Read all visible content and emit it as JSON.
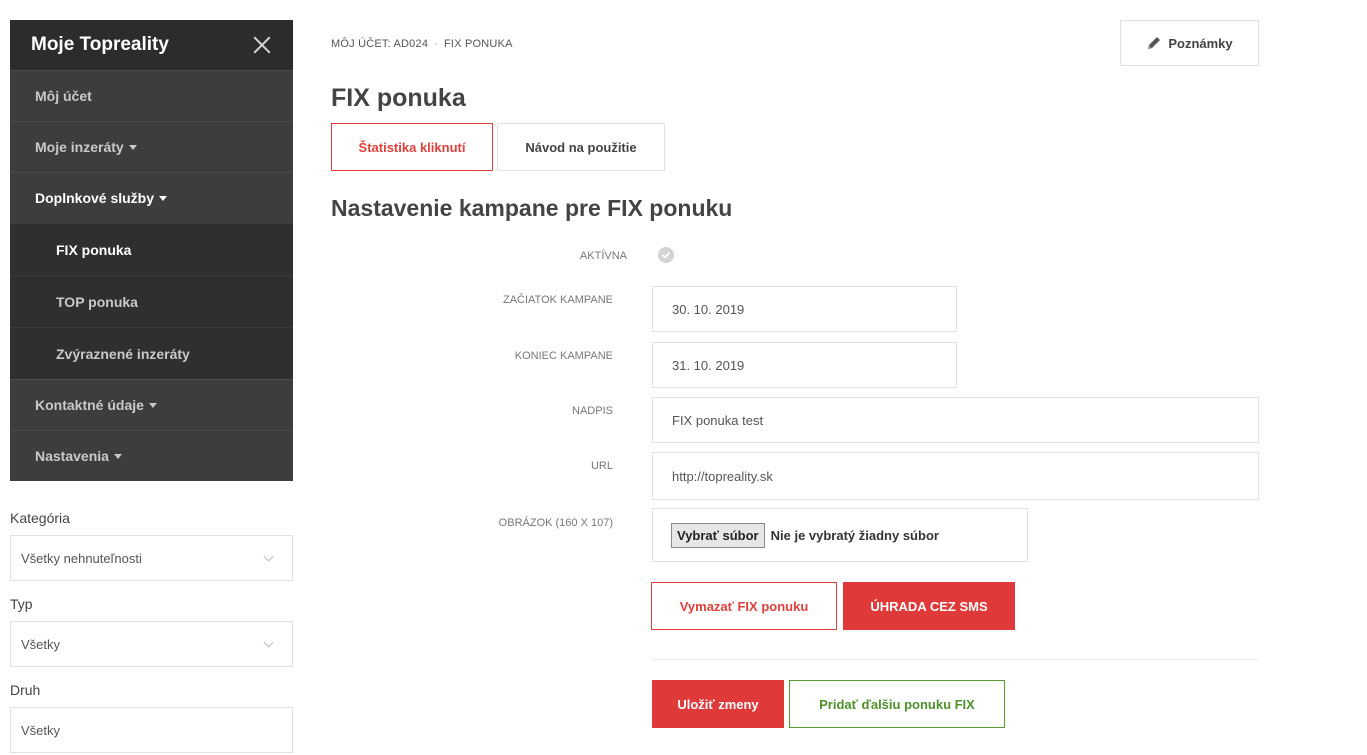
{
  "sidebar": {
    "title": "Moje Topreality",
    "items": [
      {
        "label": "Môj účet"
      },
      {
        "label": "Moje inzeráty"
      },
      {
        "label": "Doplnkové služby"
      },
      {
        "label": "Kontaktné údaje"
      },
      {
        "label": "Nastavenia"
      }
    ],
    "subitems": [
      {
        "label": "FIX ponuka"
      },
      {
        "label": "TOP ponuka"
      },
      {
        "label": "Zvýraznené inzeráty"
      }
    ]
  },
  "filters": {
    "category_label": "Kategória",
    "category_value": "Všetky nehnuteľnosti",
    "type_label": "Typ",
    "type_value": "Všetky",
    "kind_label": "Druh",
    "kind_value": "Všetky"
  },
  "header": {
    "breadcrumb": [
      "MÔJ ÚČET: AD024",
      "FIX PONUKA"
    ],
    "breadcrumb_sep": "·",
    "notes_label": "Poznámky",
    "page_title": "FIX ponuka"
  },
  "tabs": [
    {
      "label": "Štatistika kliknutí"
    },
    {
      "label": "Návod na použitie"
    }
  ],
  "form": {
    "section_title": "Nastavenie kampane pre FIX ponuku",
    "active_label": "AKTÍVNA",
    "start_label": "ZAČIATOK KAMPANE",
    "start_value": "30. 10. 2019",
    "end_label": "KONIEC KAMPANE",
    "end_value": "31. 10. 2019",
    "title_label": "NADPIS",
    "title_value": "FIX ponuka test",
    "url_label": "URL",
    "url_value": "http://topreality.sk",
    "image_label": "OBRÁZOK (160 X 107)",
    "file_button": "Vybrať súbor",
    "file_status": "Nie je vybratý žiadny súbor"
  },
  "actions": {
    "delete_label": "Vymazať FIX ponuku",
    "sms_label": "ÚHRADA CEZ SMS",
    "save_label": "Uložiť zmeny",
    "add_label": "Pridať ďalšiu ponuku FIX"
  },
  "colors": {
    "accent_red": "#e0413d",
    "accent_green": "#5a9a35",
    "sidebar_bg": "#3d3d3d"
  }
}
